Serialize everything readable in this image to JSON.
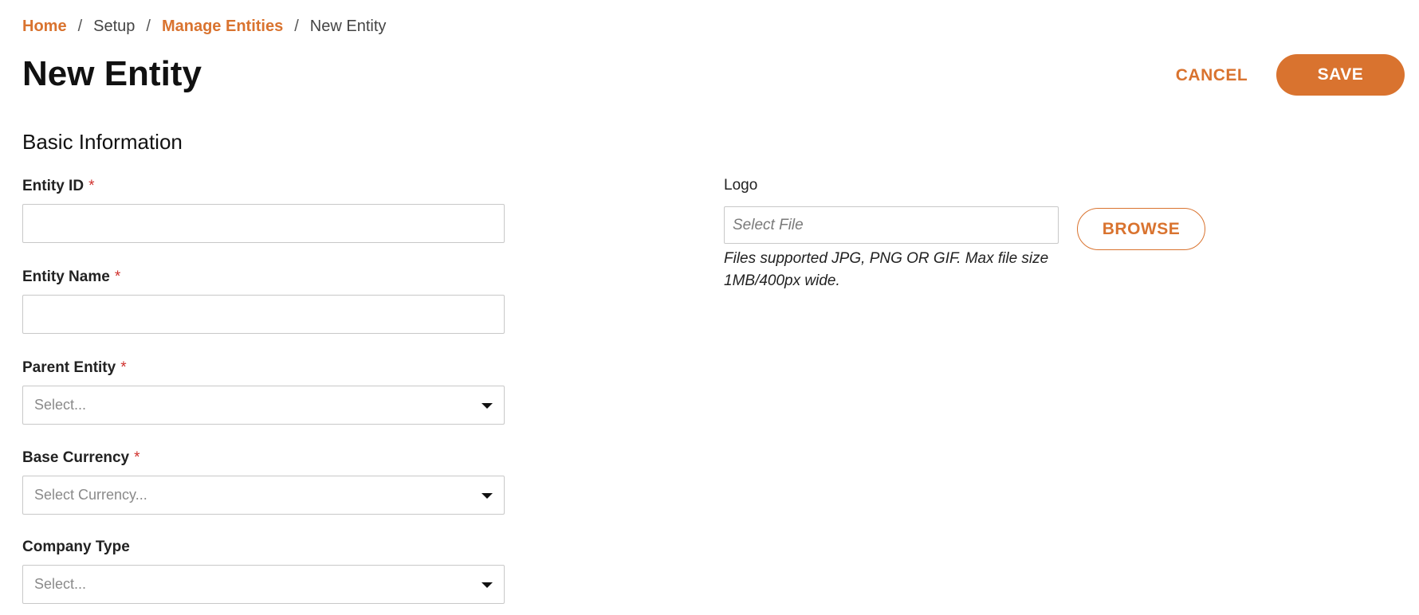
{
  "breadcrumb": {
    "items": [
      {
        "label": "Home",
        "link": true
      },
      {
        "label": "Setup",
        "link": false
      },
      {
        "label": "Manage Entities",
        "link": true
      },
      {
        "label": "New Entity",
        "link": false
      }
    ],
    "separator": "/"
  },
  "header": {
    "title": "New Entity",
    "cancel_label": "CANCEL",
    "save_label": "SAVE"
  },
  "section": {
    "title": "Basic Information"
  },
  "form": {
    "entity_id": {
      "label": "Entity ID",
      "required_mark": "*",
      "value": ""
    },
    "entity_name": {
      "label": "Entity Name",
      "required_mark": "*",
      "value": ""
    },
    "parent_entity": {
      "label": "Parent Entity",
      "required_mark": "*",
      "placeholder": "Select..."
    },
    "base_currency": {
      "label": "Base Currency",
      "required_mark": "*",
      "placeholder": "Select Currency..."
    },
    "company_type": {
      "label": "Company Type",
      "placeholder": "Select..."
    }
  },
  "logo": {
    "label": "Logo",
    "placeholder": "Select File",
    "browse_label": "BROWSE",
    "help_text": "Files supported JPG, PNG OR GIF. Max file size 1MB/400px wide."
  },
  "colors": {
    "accent": "#d9732f",
    "required": "#d0312d",
    "border": "#c8c8c8"
  },
  "icons": {
    "dropdown": "caret-down-icon"
  }
}
